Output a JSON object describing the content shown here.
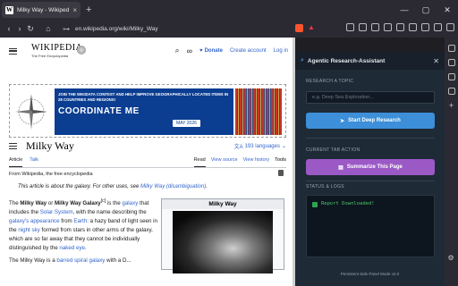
{
  "browser": {
    "tab_title": "Milky Way - Wikipedia",
    "url": "en.wikipedia.org/wiki/Milky_Way",
    "favicon_letter": "W",
    "new_tab_glyph": "+",
    "close_glyph": "×"
  },
  "wiki": {
    "logo_word": "WIKIPEDIA",
    "logo_tagline": "The Free Encyclopedia",
    "donate": "Donate",
    "create_account": "Create account",
    "login": "Log in",
    "banner": {
      "line1": "JOIN THE WIKIDATA CONTEST AND HELP IMPROVE GEOGRAPHICALLY LOCATED ITEMS IN 28 COUNTRIES AND REGIONS!",
      "line2": "COORDINATE ME",
      "date": "MAY 2026"
    },
    "title": "Milky Way",
    "languages": "193 languages",
    "tabs": {
      "article": "Article",
      "talk": "Talk",
      "read": "Read",
      "view_source": "View source",
      "view_history": "View history",
      "tools": "Tools"
    },
    "from": "From Wikipedia, the free encyclopedia",
    "hatnote_prefix": "This article is about the galaxy. For other uses, see ",
    "hatnote_link": "Milky Way (disambiguation)",
    "hatnote_suffix": ".",
    "para_html": "The <b>Milky Way</b> or <b>Milky Way Galaxy</b><sup>[c]</sup> is the <span class=\"lnk\">galaxy</span> that includes the <span class=\"lnk\">Solar System</span>, with the name describing the <span class=\"lnk\">galaxy's appearance</span> from <span class=\"lnk\">Earth</span>: a hazy band of light seen in the <span class=\"lnk\">night sky</span> formed from stars in other arms of the galaxy, which are so far away that they cannot be individually distinguished by the <span class=\"lnk\">naked eye</span>.",
    "para2_html": "The Milky Way is a <span class=\"lnk\">barred spiral galaxy</span> with a D...",
    "infobox_caption": "Milky Way"
  },
  "panel": {
    "title": "Agentic Research-Assistant",
    "research_label": "RESEARCH A TOPIC",
    "input_placeholder": "e.g. Deep Sea Exploration...",
    "start_button": "Start Deep Research",
    "current_tab_label": "CURRENT TAB ACTION",
    "summarize_button": "Summarize This Page",
    "status_label": "STATUS & LOGS",
    "log_text": "Report Downloaded!",
    "footer": "Persistent Side Panel Mode v2.0"
  }
}
